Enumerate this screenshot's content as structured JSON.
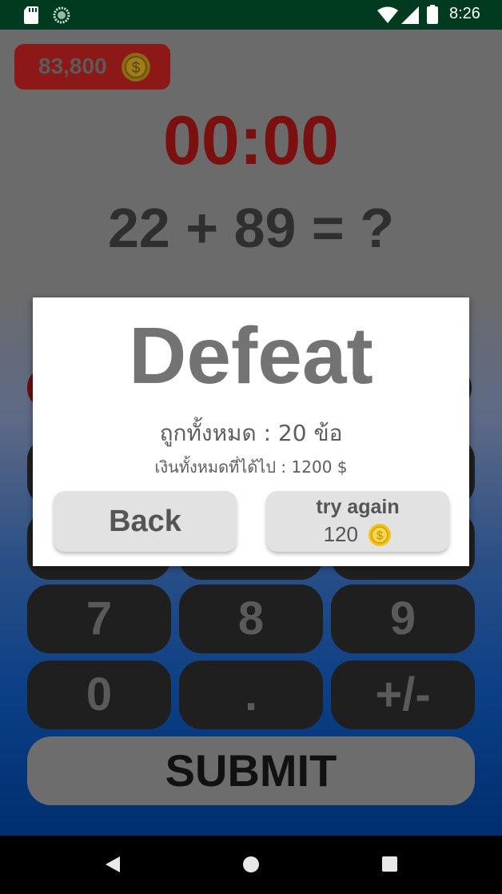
{
  "status_bar": {
    "time": "8:26",
    "icons": [
      "sd-card-icon",
      "sync-icon",
      "wifi-icon",
      "signal-icon",
      "battery-icon"
    ]
  },
  "header": {
    "coins": "83,800",
    "coin_icon": "coin-icon"
  },
  "game": {
    "timer": "00:00",
    "question": "22 + 89 = ?"
  },
  "keypad": {
    "row3": [
      "7",
      "8",
      "9"
    ],
    "row4": [
      "0",
      ".",
      "+/-"
    ],
    "submit_label": "SUBMIT"
  },
  "dialog": {
    "title": "Defeat",
    "correct_text": "ถูกทั้งหมด : 20 ข้อ",
    "earned_text": "เงินทั้งหมดที่ได้ไป : 1200 $",
    "back_label": "Back",
    "retry_label": "try again",
    "retry_cost": "120"
  },
  "colors": {
    "status_bar": "#003a1f",
    "coin_badge": "#8c1818",
    "timer": "#7a1010",
    "dialog_bg": "#ffffff",
    "button_bg": "#e2e2e2"
  },
  "nav_bar": {
    "icons": [
      "back-icon",
      "home-icon",
      "recents-icon"
    ]
  }
}
